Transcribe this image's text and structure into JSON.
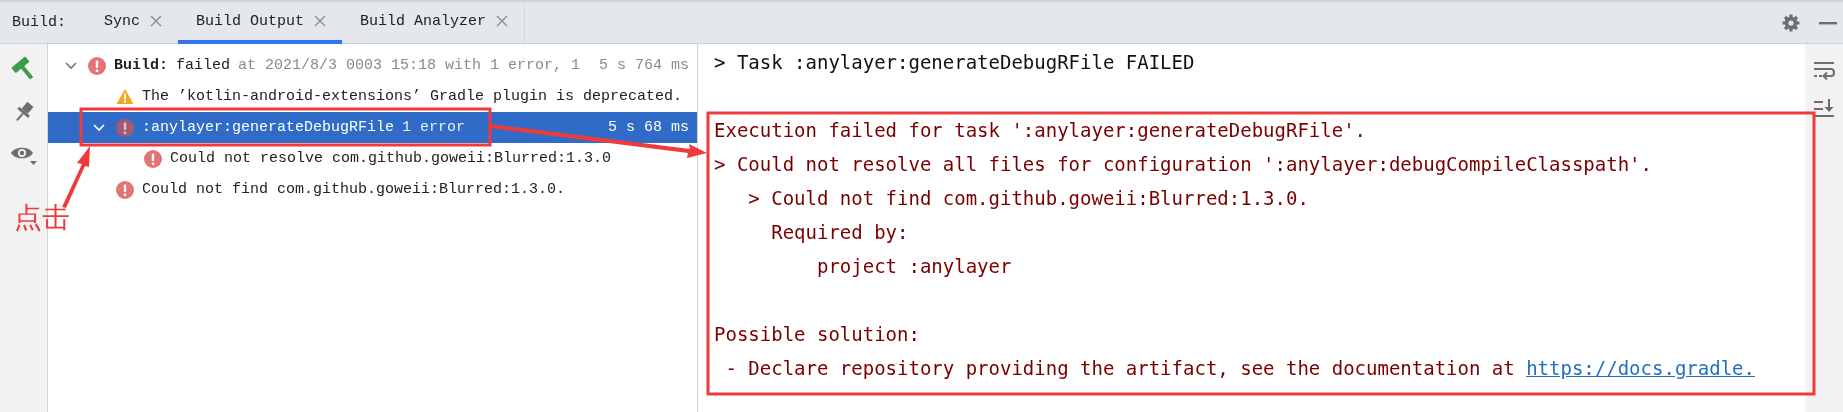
{
  "tool_window": {
    "label": "Build:",
    "tabs": [
      {
        "label": "Sync",
        "selected": false
      },
      {
        "label": "Build Output",
        "selected": true
      },
      {
        "label": "Build Analyzer",
        "selected": false
      }
    ]
  },
  "tree": {
    "nodes": [
      {
        "kind": "error",
        "title": "Build:",
        "status": "failed",
        "detail": "at 2021/8/3 0003 15:18 with 1 error, 1",
        "time": "5 s 764 ms",
        "expanded": true,
        "selected": false,
        "children": [
          {
            "kind": "warning",
            "title": "The ’kotlin-android-extensions’ Gradle plugin is deprecated.",
            "selected": false
          },
          {
            "kind": "error",
            "title": ":anylayer:generateDebugRFile",
            "detail": "1 error",
            "time": "5 s 68 ms",
            "expanded": true,
            "selected": true,
            "children": [
              {
                "kind": "error",
                "title": "Could not resolve com.github.goweii:Blurred:1.3.0",
                "selected": false
              }
            ]
          },
          {
            "kind": "error",
            "title": "Could not find com.github.goweii:Blurred:1.3.0.",
            "selected": false
          }
        ]
      }
    ]
  },
  "console": {
    "task_line": "> Task :anylayer:generateDebugRFile FAILED",
    "sections": [
      {
        "lines": [
          {
            "text": "Execution failed for task ':anylayer:generateDebugRFile'."
          },
          {
            "text": "> Could not resolve all files for configuration ':anylayer:debugCompileClasspath'."
          },
          {
            "text": "   > Could not find com.github.goweii:Blurred:1.3.0."
          },
          {
            "text": "     Required by:"
          },
          {
            "text": "         project :anylayer"
          }
        ]
      },
      {
        "lines": [
          {
            "text": "Possible solution:"
          },
          {
            "text": " - Declare repository providing the artifact, see the documentation at ",
            "link": "https://docs.gradle."
          }
        ]
      }
    ]
  },
  "annotation": {
    "label": "点击"
  }
}
